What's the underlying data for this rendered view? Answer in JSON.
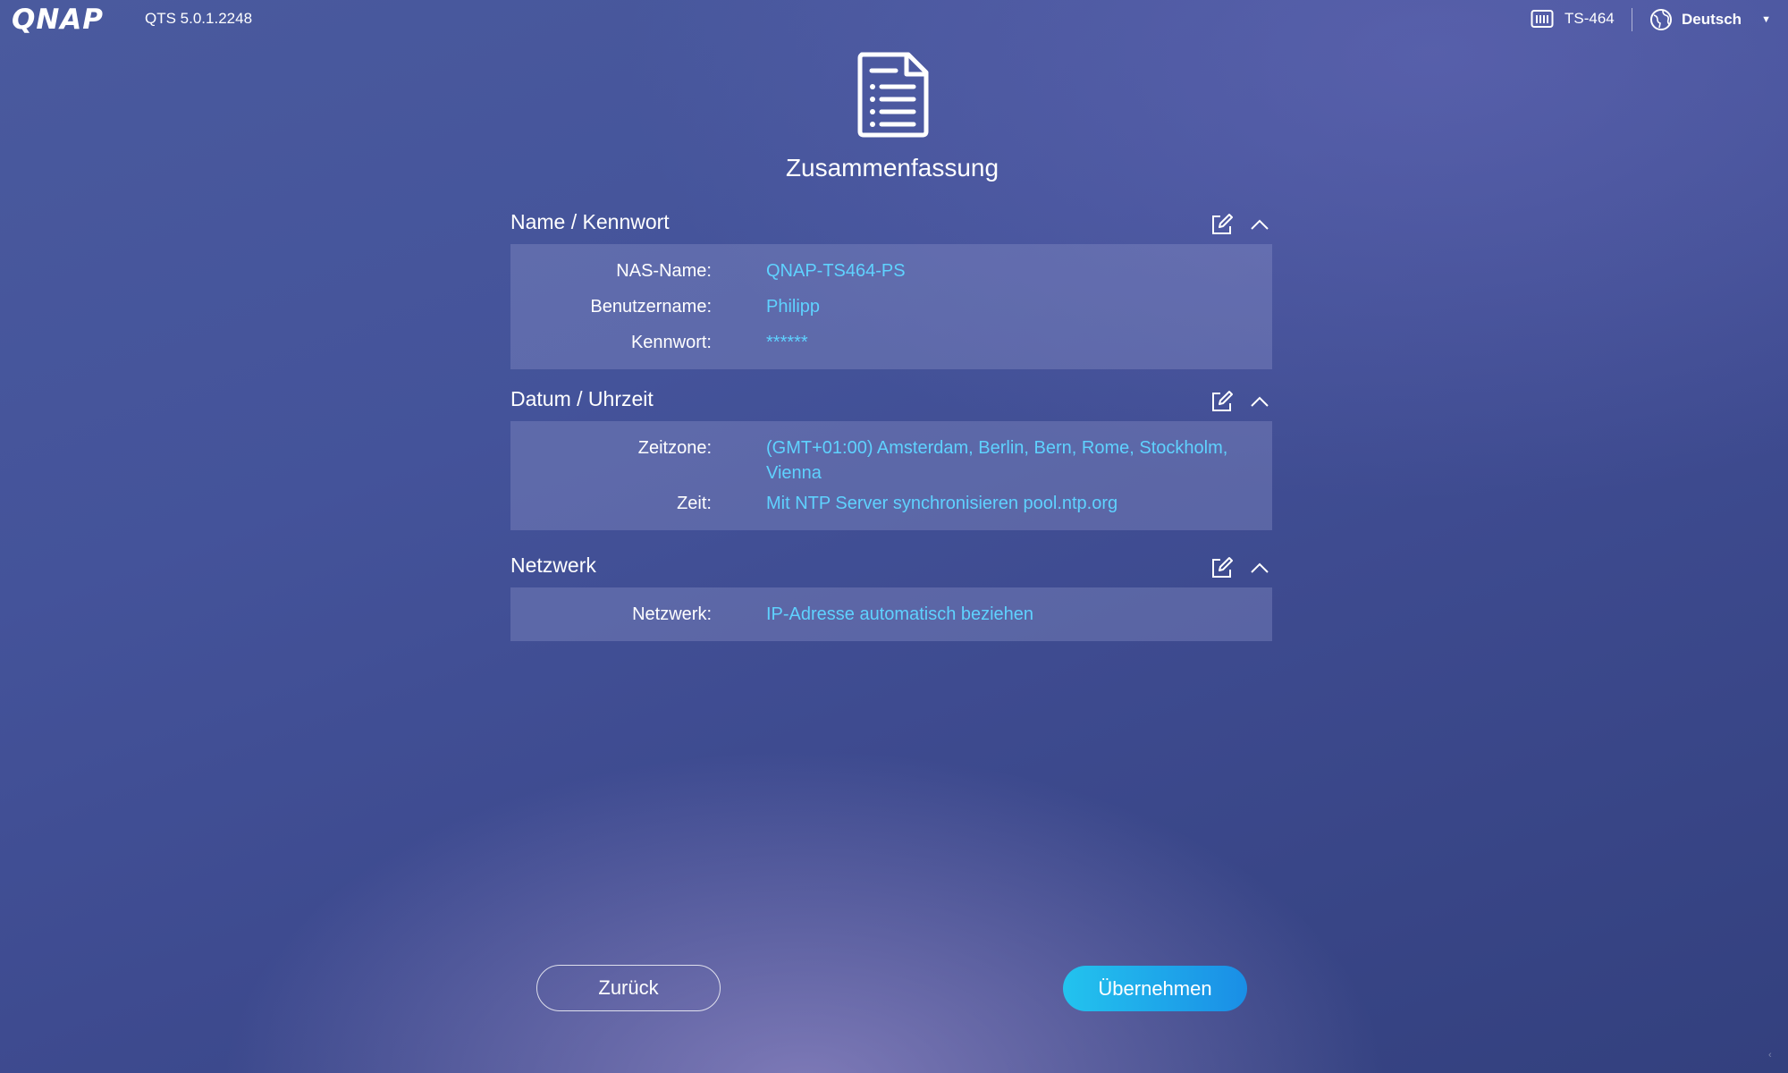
{
  "topbar": {
    "logo": "QNAP",
    "version": "QTS 5.0.1.2248",
    "device": "TS-464",
    "language": "Deutsch"
  },
  "header": {
    "title": "Zusammenfassung"
  },
  "sections": [
    {
      "title": "Name / Kennwort",
      "rows": [
        {
          "label": "NAS-Name:",
          "value": "QNAP-TS464-PS"
        },
        {
          "label": "Benutzername:",
          "value": "Philipp"
        },
        {
          "label": "Kennwort:",
          "value": "******"
        }
      ]
    },
    {
      "title": "Datum / Uhrzeit",
      "rows": [
        {
          "label": "Zeitzone:",
          "value": "(GMT+01:00) Amsterdam, Berlin, Bern, Rome, Stockholm, Vienna"
        },
        {
          "label": "Zeit:",
          "value": "Mit NTP Server synchronisieren pool.ntp.org"
        }
      ]
    },
    {
      "title": "Netzwerk",
      "rows": [
        {
          "label": "Netzwerk:",
          "value": "IP-Adresse automatisch beziehen"
        }
      ]
    }
  ],
  "buttons": {
    "back": "Zurück",
    "apply": "Übernehmen"
  },
  "colors": {
    "value_text": "#5fd2ff",
    "apply_start": "#23c3ee",
    "apply_end": "#1a8ee6"
  }
}
